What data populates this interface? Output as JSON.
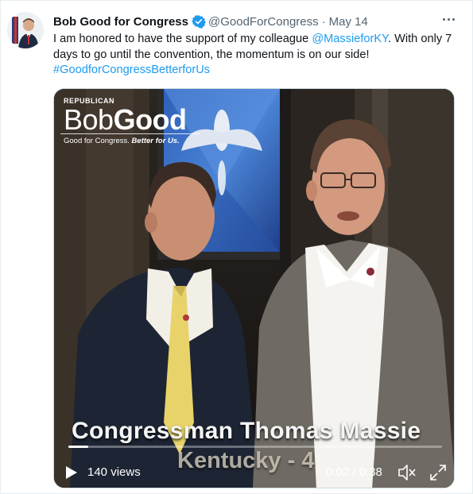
{
  "tweet": {
    "display_name": "Bob Good for Congress",
    "handle": "@GoodForCongress",
    "separator": "·",
    "date": "May 14",
    "text_part1": "I am honored to have the support of my colleague ",
    "mention": "@MassieforKY",
    "text_part2": ". With only 7 days to go until the convention, the momentum is on our side!",
    "hashtag": "#GoodforCongressBetterforUs",
    "more_icon": "more-dots-icon",
    "verified_icon": "verified-badge-icon"
  },
  "video": {
    "logo": {
      "small": "REPUBLICAN",
      "name_part1": "Bob",
      "name_part2": "Good",
      "tagline_part1": "Good for Congress.",
      "tagline_part2": " Better for Us."
    },
    "caption_line1": "Congressman Thomas Massie",
    "caption_line2": "Kentucky - 4",
    "views": "140 views",
    "time": "0:02 / 0:38",
    "progress": 0.053,
    "play_icon": "play-icon",
    "mute_icon": "mute-icon",
    "fullscreen_icon": "fullscreen-icon"
  },
  "colors": {
    "accent": "#1d9bf0",
    "secondary_text": "#536471"
  }
}
